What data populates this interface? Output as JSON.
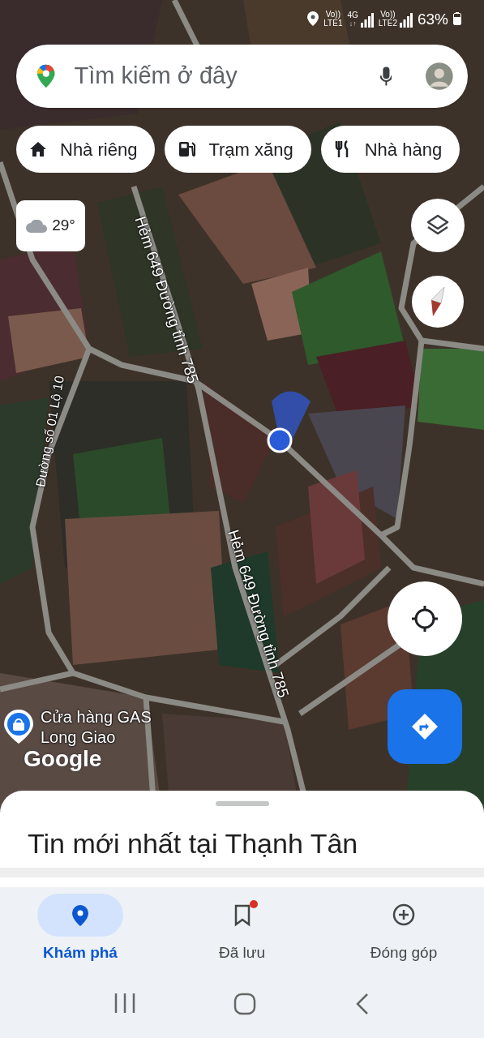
{
  "status_bar": {
    "indicators": [
      {
        "kind": "sim",
        "top": "Vo))",
        "bottom": "LTE1"
      },
      {
        "kind": "data",
        "top": "4G",
        "bottom": "↓↑"
      },
      {
        "kind": "sim",
        "top": "Vo))",
        "bottom": "LTE2"
      }
    ],
    "battery": "63%"
  },
  "search": {
    "placeholder": "Tìm kiếm ở đây"
  },
  "chips": [
    {
      "kind": "home",
      "label": "Nhà riêng"
    },
    {
      "kind": "gas",
      "label": "Trạm xăng"
    },
    {
      "kind": "restaurant",
      "label": "Nhà hàng"
    }
  ],
  "weather": {
    "temperature": "29°"
  },
  "map_labels": [
    {
      "kind": "road",
      "text": "Hẻm 649 Đường tỉnh 785"
    },
    {
      "kind": "road",
      "text": "Đường số 01 Lộ 10"
    },
    {
      "kind": "road",
      "text": "Hẻm 649 Đường tỉnh 785"
    }
  ],
  "place": {
    "name": "Cửa hàng GAS Long Giao"
  },
  "attribution": "Google",
  "sheet": {
    "title": "Tin mới nhất tại Thạnh Tân"
  },
  "nav": [
    {
      "kind": "explore",
      "label": "Khám phá",
      "selected": true,
      "badge": false
    },
    {
      "kind": "saved",
      "label": "Đã lưu",
      "selected": false,
      "badge": true
    },
    {
      "kind": "contribute",
      "label": "Đóng góp",
      "selected": false,
      "badge": false
    }
  ]
}
